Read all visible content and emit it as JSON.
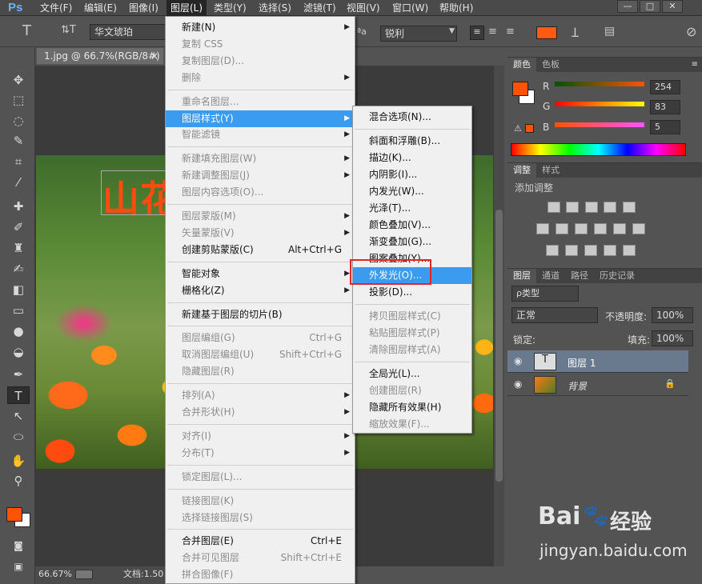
{
  "menubar": {
    "logo": "Ps",
    "items": [
      "文件(F)",
      "编辑(E)",
      "图像(I)",
      "图层(L)",
      "类型(Y)",
      "选择(S)",
      "滤镜(T)",
      "视图(V)",
      "窗口(W)",
      "帮助(H)"
    ],
    "window_buttons": [
      "—",
      "□",
      "✕"
    ]
  },
  "optbar": {
    "type_tool": "T",
    "orient": "⇅T",
    "font": "华文琥珀",
    "aa_label": "ªa",
    "aa_value": "锐利",
    "color": "#ff5a14"
  },
  "document": {
    "tab": "1.jpg @ 66.7%(RGB/8#)",
    "tab_close": "×",
    "text": "山花",
    "zoom": "66.67%",
    "doc_info": "文档:1.50"
  },
  "color_panel": {
    "tabs": [
      "颜色",
      "色板"
    ],
    "r_label": "R",
    "g_label": "G",
    "b_label": "B",
    "r": "254",
    "g": "83",
    "b": "5",
    "fg": "#fe5305"
  },
  "adjust_panel": {
    "tabs": [
      "调整",
      "样式"
    ],
    "title": "添加调整"
  },
  "layers_panel": {
    "tabs": [
      "图层",
      "通道",
      "路径",
      "历史记录"
    ],
    "kind": "ρ类型",
    "blend": "正常",
    "opacity_label": "不透明度:",
    "opacity": "100%",
    "lock_label": "锁定:",
    "fill_label": "填充:",
    "fill": "100%",
    "layers": [
      {
        "name": "图层 1",
        "type": "T"
      },
      {
        "name": "背景"
      }
    ]
  },
  "layer_menu": {
    "items": [
      {
        "label": "新建(N)",
        "arrow": true
      },
      {
        "label": "复制 CSS",
        "dis": true
      },
      {
        "label": "复制图层(D)...",
        "dis": true
      },
      {
        "label": "删除",
        "dis": true,
        "arrow": true
      },
      {
        "sep": true
      },
      {
        "label": "重命名图层...",
        "dis": true
      },
      {
        "label": "图层样式(Y)",
        "hl": true,
        "arrow": true
      },
      {
        "label": "智能滤镜",
        "dis": true,
        "arrow": true
      },
      {
        "sep": true
      },
      {
        "label": "新建填充图层(W)",
        "dis": true,
        "arrow": true
      },
      {
        "label": "新建调整图层(J)",
        "dis": true,
        "arrow": true
      },
      {
        "label": "图层内容选项(O)...",
        "dis": true
      },
      {
        "sep": true
      },
      {
        "label": "图层蒙版(M)",
        "dis": true,
        "arrow": true
      },
      {
        "label": "矢量蒙版(V)",
        "dis": true,
        "arrow": true
      },
      {
        "label": "创建剪贴蒙版(C)",
        "sc": "Alt+Ctrl+G"
      },
      {
        "sep": true
      },
      {
        "label": "智能对象",
        "arrow": true
      },
      {
        "label": "栅格化(Z)",
        "arrow": true
      },
      {
        "sep": true
      },
      {
        "label": "新建基于图层的切片(B)"
      },
      {
        "sep": true
      },
      {
        "label": "图层编组(G)",
        "dis": true,
        "sc": "Ctrl+G"
      },
      {
        "label": "取消图层编组(U)",
        "dis": true,
        "sc": "Shift+Ctrl+G"
      },
      {
        "label": "隐藏图层(R)",
        "dis": true
      },
      {
        "sep": true
      },
      {
        "label": "排列(A)",
        "dis": true,
        "arrow": true
      },
      {
        "label": "合并形状(H)",
        "dis": true,
        "arrow": true
      },
      {
        "sep": true
      },
      {
        "label": "对齐(I)",
        "dis": true,
        "arrow": true
      },
      {
        "label": "分布(T)",
        "dis": true,
        "arrow": true
      },
      {
        "sep": true
      },
      {
        "label": "锁定图层(L)...",
        "dis": true
      },
      {
        "sep": true
      },
      {
        "label": "链接图层(K)",
        "dis": true
      },
      {
        "label": "选择链接图层(S)",
        "dis": true
      },
      {
        "sep": true
      },
      {
        "label": "合并图层(E)",
        "sc": "Ctrl+E"
      },
      {
        "label": "合并可见图层",
        "dis": true,
        "sc": "Shift+Ctrl+E"
      },
      {
        "label": "拼合图像(F)",
        "dis": true
      }
    ]
  },
  "style_menu": {
    "items": [
      {
        "label": "混合选项(N)..."
      },
      {
        "sep": true
      },
      {
        "label": "斜面和浮雕(B)..."
      },
      {
        "label": "描边(K)..."
      },
      {
        "label": "内阴影(I)..."
      },
      {
        "label": "内发光(W)..."
      },
      {
        "label": "光泽(T)..."
      },
      {
        "label": "颜色叠加(V)..."
      },
      {
        "label": "渐变叠加(G)..."
      },
      {
        "label": "图案叠加(Y)..."
      },
      {
        "label": "外发光(O)...",
        "hl": true
      },
      {
        "label": "投影(D)..."
      },
      {
        "sep": true
      },
      {
        "label": "拷贝图层样式(C)",
        "dis": true
      },
      {
        "label": "粘贴图层样式(P)",
        "dis": true
      },
      {
        "label": "清除图层样式(A)",
        "dis": true
      },
      {
        "sep": true
      },
      {
        "label": "全局光(L)..."
      },
      {
        "label": "创建图层(R)",
        "dis": true
      },
      {
        "label": "隐藏所有效果(H)"
      },
      {
        "label": "缩放效果(F)...",
        "dis": true
      }
    ]
  },
  "watermark": {
    "brand_a": "Bai",
    "brand_b": "经验",
    "url": "jingyan.baidu.com"
  }
}
